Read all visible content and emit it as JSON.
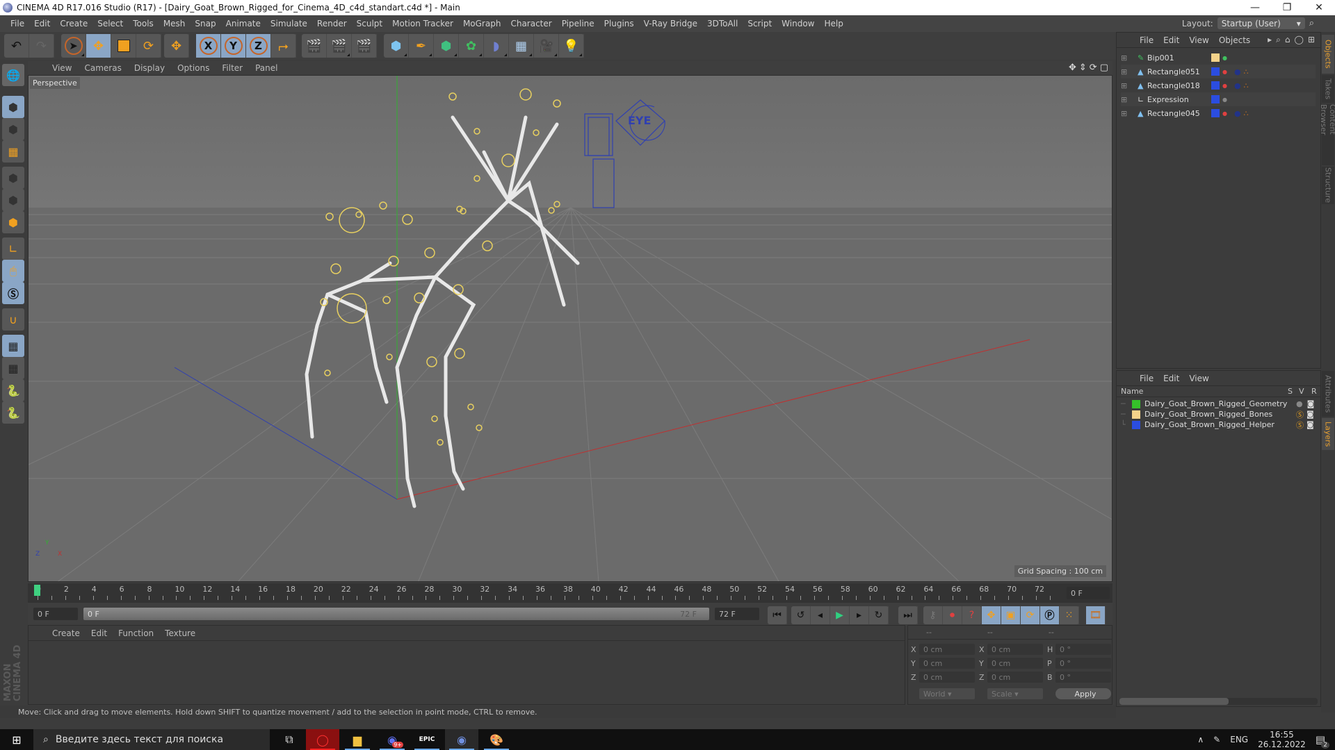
{
  "window": {
    "title": "CINEMA 4D R17.016 Studio (R17) - [Dairy_Goat_Brown_Rigged_for_Cinema_4D_c4d_standart.c4d *] - Main",
    "controls": {
      "minimize": "—",
      "restore": "❐",
      "close": "✕"
    }
  },
  "menubar": {
    "items": [
      "File",
      "Edit",
      "Create",
      "Select",
      "Tools",
      "Mesh",
      "Snap",
      "Animate",
      "Simulate",
      "Render",
      "Sculpt",
      "Motion Tracker",
      "MoGraph",
      "Character",
      "Pipeline",
      "Plugins",
      "V-Ray Bridge",
      "3DToAll",
      "Script",
      "Window",
      "Help"
    ],
    "layout_label": "Layout:",
    "layout_value": "Startup (User)"
  },
  "toolbar": {
    "undo_icon": "undo-icon",
    "redo_icon": "redo-icon",
    "x_label": "X",
    "y_label": "Y",
    "z_label": "Z"
  },
  "viewport": {
    "menu": [
      "View",
      "Cameras",
      "Display",
      "Options",
      "Filter",
      "Panel"
    ],
    "camera_label": "Perspective",
    "grid_spacing": "Grid Spacing : 100 cm",
    "gizmo": {
      "x": "X",
      "y": "Y",
      "z": "Z"
    },
    "accent_x": "#c03030",
    "accent_y": "#30b030",
    "accent_z": "#3040b0"
  },
  "timeline": {
    "ticks": [
      "0",
      "2",
      "4",
      "6",
      "8",
      "10",
      "12",
      "14",
      "16",
      "18",
      "20",
      "22",
      "24",
      "26",
      "28",
      "30",
      "32",
      "34",
      "36",
      "38",
      "40",
      "42",
      "44",
      "46",
      "48",
      "50",
      "52",
      "54",
      "56",
      "58",
      "60",
      "62",
      "64",
      "66",
      "68",
      "70",
      "72"
    ],
    "current_frame": "0 F",
    "start_frame": "0 F",
    "range_start": "0 F",
    "range_end": "72 F",
    "end_frame": "72 F",
    "playhead_fraction": 0
  },
  "material_panel": {
    "menu": [
      "Create",
      "Edit",
      "Function",
      "Texture"
    ]
  },
  "coord_panel": {
    "headers": [
      "--",
      "--",
      "--"
    ],
    "rows": [
      {
        "l1": "X",
        "v1": "0 cm",
        "l2": "X",
        "v2": "0 cm",
        "l3": "H",
        "v3": "0 °"
      },
      {
        "l1": "Y",
        "v1": "0 cm",
        "l2": "Y",
        "v2": "0 cm",
        "l3": "P",
        "v3": "0 °"
      },
      {
        "l1": "Z",
        "v1": "0 cm",
        "l2": "Z",
        "v2": "0 cm",
        "l3": "B",
        "v3": "0 °"
      }
    ],
    "space": "World",
    "mode": "Scale",
    "apply": "Apply"
  },
  "status": "Move: Click and drag to move elements. Hold down SHIFT to quantize movement / add to the selection in point mode, CTRL to remove.",
  "object_manager": {
    "menu": [
      "File",
      "Edit",
      "View",
      "Objects"
    ],
    "objects": [
      {
        "name": "Bip001",
        "icon": "bone-icon",
        "color": "#f5d38a"
      },
      {
        "name": "Rectangle051",
        "icon": "polygon-icon",
        "color": "#2b4de0"
      },
      {
        "name": "Rectangle018",
        "icon": "polygon-icon",
        "color": "#2b4de0"
      },
      {
        "name": "Expression",
        "icon": "null-icon",
        "color": "#2b4de0"
      },
      {
        "name": "Rectangle045",
        "icon": "polygon-icon",
        "color": "#2b4de0"
      }
    ]
  },
  "layer_manager": {
    "menu": [
      "File",
      "Edit",
      "View"
    ],
    "columns": [
      "Name",
      "S",
      "V",
      "R"
    ],
    "layers": [
      {
        "name": "Dairy_Goat_Brown_Rigged_Geometry",
        "color": "#35c02a"
      },
      {
        "name": "Dairy_Goat_Brown_Rigged_Bones",
        "color": "#f5d38a"
      },
      {
        "name": "Dairy_Goat_Brown_Rigged_Helper",
        "color": "#2b4de0"
      }
    ]
  },
  "side_tabs": {
    "top": [
      "Objects",
      "Takes",
      "Content Browser",
      "Structure"
    ],
    "bottom": [
      "Attributes",
      "Layers"
    ]
  },
  "logo": "MAXON CINEMA 4D",
  "taskbar": {
    "search_placeholder": "Введите здесь текст для поиска",
    "apps": [
      "task-view",
      "opera",
      "file-explorer",
      "discord",
      "epic-games",
      "cinema4d",
      "paint"
    ],
    "discord_badge": "9+",
    "lang": "ENG",
    "time": "16:55",
    "date": "26.12.2022",
    "notifications": "2"
  }
}
